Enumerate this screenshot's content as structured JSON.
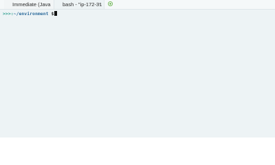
{
  "tabs": [
    {
      "label": "Immediate (Java",
      "active": false
    },
    {
      "label": "bash - \"ip-172-31",
      "active": true
    }
  ],
  "tab_close_glyph": "×",
  "add_tab_icon": "add-tab-icon",
  "terminal": {
    "prompt_arrows": ">>>:",
    "prompt_path": "~/environment",
    "prompt_dollar": "$"
  },
  "colors": {
    "terminal_background": "#edf3f5",
    "prompt_arrows": "#2e9f8f",
    "prompt_path": "#2f6d9d",
    "add_tab": "#74b85a"
  }
}
